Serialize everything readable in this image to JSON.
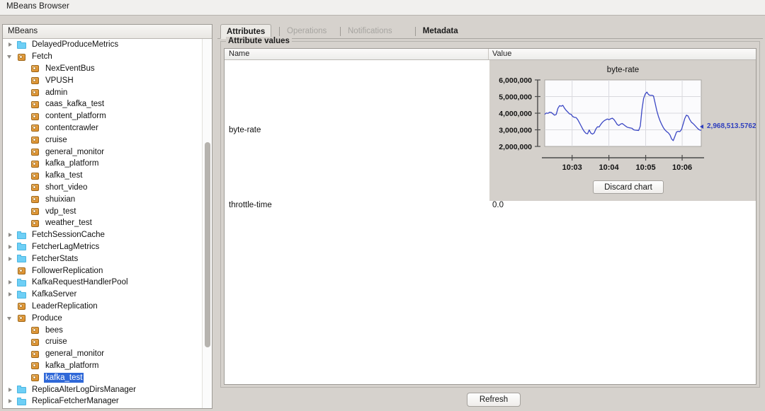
{
  "window": {
    "title": "MBeans Browser"
  },
  "tree": {
    "header": "MBeans",
    "items": [
      {
        "label": "DelayedProduceMetrics",
        "icon": "folder-icon",
        "depth": 1,
        "arrow": "collapsed",
        "selected": false
      },
      {
        "label": "Fetch",
        "icon": "mbean-icon",
        "depth": 1,
        "arrow": "expanded",
        "selected": false
      },
      {
        "label": "NexEventBus",
        "icon": "mbean-icon",
        "depth": 2,
        "arrow": "none",
        "selected": false
      },
      {
        "label": "VPUSH",
        "icon": "mbean-icon",
        "depth": 2,
        "arrow": "none",
        "selected": false
      },
      {
        "label": "admin",
        "icon": "mbean-icon",
        "depth": 2,
        "arrow": "none",
        "selected": false
      },
      {
        "label": "caas_kafka_test",
        "icon": "mbean-icon",
        "depth": 2,
        "arrow": "none",
        "selected": false
      },
      {
        "label": "content_platform",
        "icon": "mbean-icon",
        "depth": 2,
        "arrow": "none",
        "selected": false
      },
      {
        "label": "contentcrawler",
        "icon": "mbean-icon",
        "depth": 2,
        "arrow": "none",
        "selected": false
      },
      {
        "label": "cruise",
        "icon": "mbean-icon",
        "depth": 2,
        "arrow": "none",
        "selected": false
      },
      {
        "label": "general_monitor",
        "icon": "mbean-icon",
        "depth": 2,
        "arrow": "none",
        "selected": false
      },
      {
        "label": "kafka_platform",
        "icon": "mbean-icon",
        "depth": 2,
        "arrow": "none",
        "selected": false
      },
      {
        "label": "kafka_test",
        "icon": "mbean-icon",
        "depth": 2,
        "arrow": "none",
        "selected": false
      },
      {
        "label": "short_video",
        "icon": "mbean-icon",
        "depth": 2,
        "arrow": "none",
        "selected": false
      },
      {
        "label": "shuixian",
        "icon": "mbean-icon",
        "depth": 2,
        "arrow": "none",
        "selected": false
      },
      {
        "label": "vdp_test",
        "icon": "mbean-icon",
        "depth": 2,
        "arrow": "none",
        "selected": false
      },
      {
        "label": "weather_test",
        "icon": "mbean-icon",
        "depth": 2,
        "arrow": "none",
        "selected": false
      },
      {
        "label": "FetchSessionCache",
        "icon": "folder-icon",
        "depth": 1,
        "arrow": "collapsed",
        "selected": false
      },
      {
        "label": "FetcherLagMetrics",
        "icon": "folder-icon",
        "depth": 1,
        "arrow": "collapsed",
        "selected": false
      },
      {
        "label": "FetcherStats",
        "icon": "folder-icon",
        "depth": 1,
        "arrow": "collapsed",
        "selected": false
      },
      {
        "label": "FollowerReplication",
        "icon": "mbean-icon",
        "depth": 1,
        "arrow": "none",
        "selected": false
      },
      {
        "label": "KafkaRequestHandlerPool",
        "icon": "folder-icon",
        "depth": 1,
        "arrow": "collapsed",
        "selected": false
      },
      {
        "label": "KafkaServer",
        "icon": "folder-icon",
        "depth": 1,
        "arrow": "collapsed",
        "selected": false
      },
      {
        "label": "LeaderReplication",
        "icon": "mbean-icon",
        "depth": 1,
        "arrow": "none",
        "selected": false
      },
      {
        "label": "Produce",
        "icon": "mbean-icon",
        "depth": 1,
        "arrow": "expanded",
        "selected": false
      },
      {
        "label": "bees",
        "icon": "mbean-icon",
        "depth": 2,
        "arrow": "none",
        "selected": false
      },
      {
        "label": "cruise",
        "icon": "mbean-icon",
        "depth": 2,
        "arrow": "none",
        "selected": false
      },
      {
        "label": "general_monitor",
        "icon": "mbean-icon",
        "depth": 2,
        "arrow": "none",
        "selected": false
      },
      {
        "label": "kafka_platform",
        "icon": "mbean-icon",
        "depth": 2,
        "arrow": "none",
        "selected": false
      },
      {
        "label": "kafka_test",
        "icon": "mbean-icon",
        "depth": 2,
        "arrow": "none",
        "selected": true
      },
      {
        "label": "ReplicaAlterLogDirsManager",
        "icon": "folder-icon",
        "depth": 1,
        "arrow": "collapsed",
        "selected": false
      },
      {
        "label": "ReplicaFetcherManager",
        "icon": "folder-icon",
        "depth": 1,
        "arrow": "collapsed",
        "selected": false
      }
    ]
  },
  "tabs": [
    {
      "label": "Attributes",
      "state": "active"
    },
    {
      "label": "Operations",
      "state": "disabled"
    },
    {
      "label": "Notifications",
      "state": "disabled"
    },
    {
      "label": "Metadata",
      "state": "enabled"
    }
  ],
  "attributes_panel": {
    "group_title": "Attribute values",
    "columns": [
      "Name",
      "Value"
    ],
    "rows": [
      {
        "name": "byte-rate",
        "value": ""
      },
      {
        "name": "throttle-time",
        "value": "0.0"
      }
    ],
    "discard_chart_label": "Discard chart",
    "current_value_label": "2,968,513.5762"
  },
  "footer": {
    "refresh_label": "Refresh"
  },
  "colors": {
    "selection_blue": "#2f68d8",
    "chart_line": "#3b47c4",
    "folder_icon": "#6ecff6",
    "mbean_icon": "#e09b39"
  },
  "chart_data": {
    "type": "line",
    "title": "byte-rate",
    "xlabel": "",
    "ylabel": "",
    "ylim": [
      2000000,
      6000000
    ],
    "yticks": [
      "2,000,000",
      "3,000,000",
      "4,000,000",
      "5,000,000",
      "6,000,000"
    ],
    "ytick_values": [
      2000000,
      3000000,
      4000000,
      5000000,
      6000000
    ],
    "xticks": [
      "10:03",
      "10:04",
      "10:05",
      "10:06"
    ],
    "grid": true,
    "legend": "none",
    "current_value": 2968513.5762,
    "series": [
      {
        "name": "byte-rate",
        "values": [
          3930000,
          4010000,
          3990000,
          4060000,
          4040000,
          3960000,
          3880000,
          3930000,
          4290000,
          4450000,
          4420000,
          4470000,
          4300000,
          4170000,
          4070000,
          3960000,
          3930000,
          3800000,
          3750000,
          3740000,
          3620000,
          3440000,
          3250000,
          3060000,
          2900000,
          2790000,
          2760000,
          2990000,
          2800000,
          2740000,
          2810000,
          3040000,
          3180000,
          3170000,
          3320000,
          3450000,
          3540000,
          3600000,
          3650000,
          3610000,
          3660000,
          3700000,
          3620000,
          3480000,
          3320000,
          3260000,
          3340000,
          3380000,
          3310000,
          3230000,
          3160000,
          3130000,
          3110000,
          3090000,
          3000000,
          2980000,
          2970000,
          2960000,
          3220000,
          4200000,
          4880000,
          5150000,
          5270000,
          5120000,
          5070000,
          5080000,
          5040000,
          4610000,
          4160000,
          3810000,
          3540000,
          3320000,
          3130000,
          2990000,
          2890000,
          2820000,
          2690000,
          2450000,
          2350000,
          2600000,
          2870000,
          2910000,
          2890000,
          3010000,
          3340000,
          3680000,
          3880000,
          3830000,
          3620000,
          3460000,
          3380000,
          3280000,
          3170000,
          3060000,
          2990000,
          2968513
        ]
      }
    ]
  }
}
